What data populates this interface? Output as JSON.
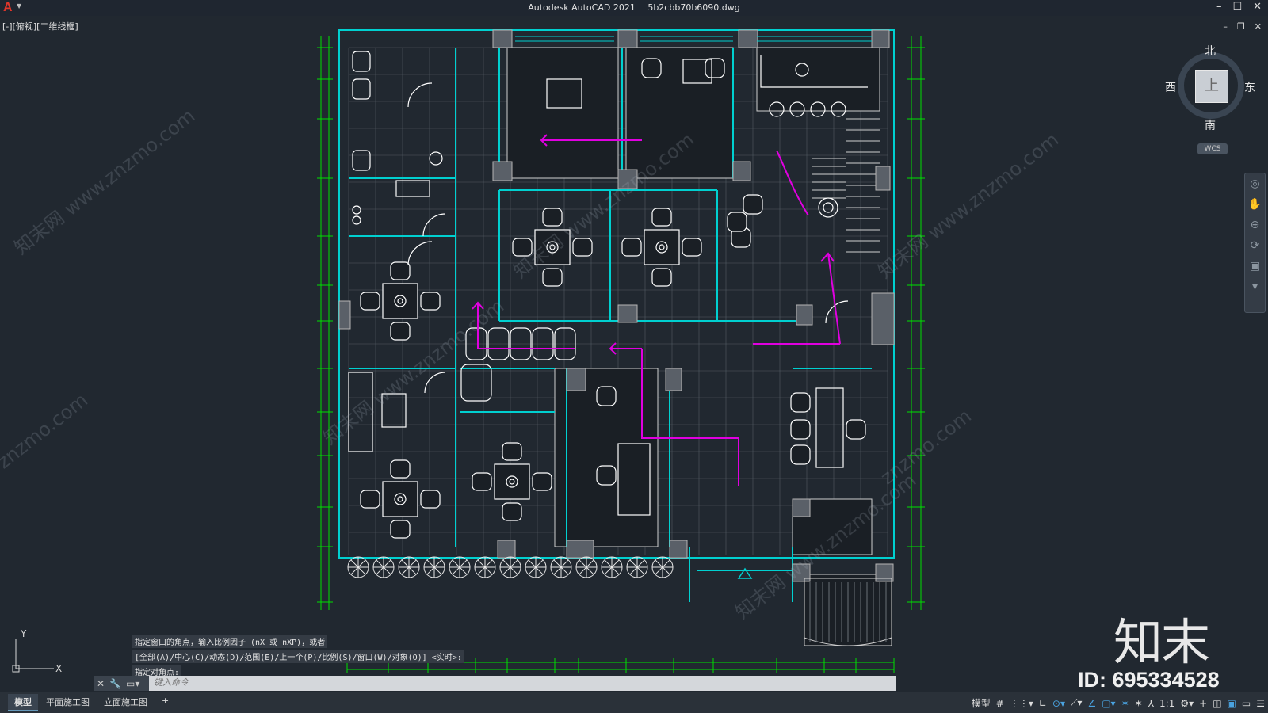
{
  "window": {
    "app_title": "Autodesk AutoCAD 2021",
    "file_name": "5b2cbb70b6090.dwg",
    "controls": [
      "–",
      "☐",
      "✕"
    ],
    "doc_controls": [
      "–",
      "❐",
      "✕"
    ]
  },
  "viewport": {
    "label": "[-][俯视][二维线框]"
  },
  "viewcube": {
    "north": "北",
    "south": "南",
    "west": "西",
    "east": "东",
    "face": "上",
    "wcs": "WCS"
  },
  "ucs": {
    "x": "X",
    "y": "Y"
  },
  "command": {
    "history": [
      "指定窗口的角点，输入比例因子 (nX 或 nXP)，或者",
      "[全部(A)/中心(C)/动态(D)/范围(E)/上一个(P)/比例(S)/窗口(W)/对象(O)] <实时>:",
      "指定对角点:"
    ],
    "placeholder": "键入命令"
  },
  "layouts": {
    "tabs": [
      "模型",
      "平面施工图",
      "立面施工图"
    ],
    "add": "+"
  },
  "status": {
    "model_label": "模型",
    "scale": "1:1"
  },
  "watermarks": [
    "知末网 www.znzmo.com",
    "znzmo.com"
  ],
  "brand": {
    "logo": "知末",
    "id": "ID: 695334528"
  },
  "colors": {
    "background": "#212830",
    "wall": "#00d0d0",
    "dimension": "#00e000",
    "arrow": "#e000e0",
    "furniture": "#ffffff"
  }
}
